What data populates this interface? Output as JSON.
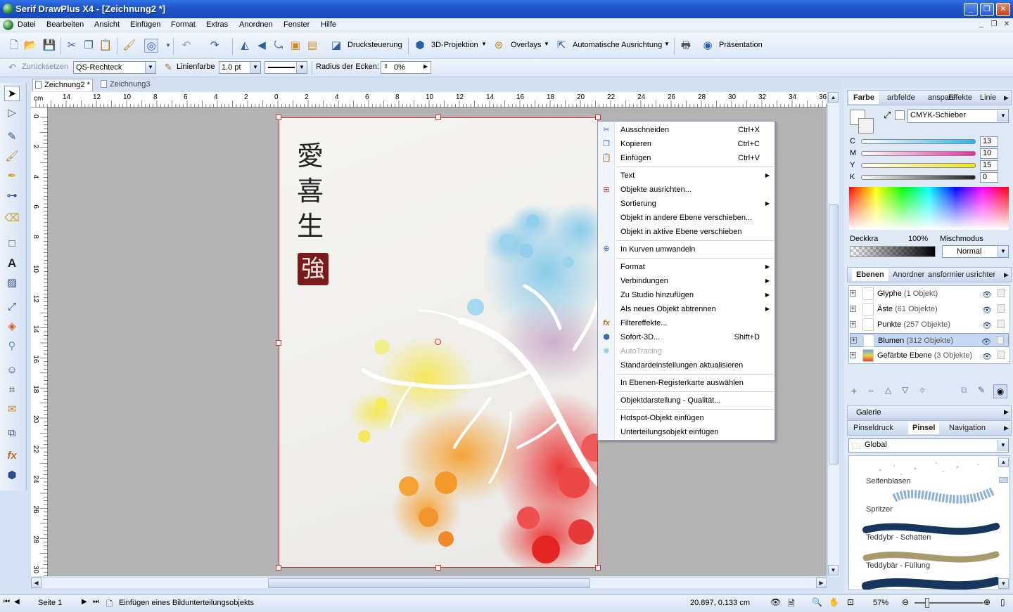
{
  "window": {
    "title": "Serif DrawPlus X4 - [Zeichnung2 *]",
    "min": "_",
    "max": "❐",
    "close": "✕"
  },
  "menu": [
    "Datei",
    "Bearbeiten",
    "Ansicht",
    "Einfügen",
    "Format",
    "Extras",
    "Anordnen",
    "Fenster",
    "Hilfe"
  ],
  "toolbar1": {
    "druck": "Drucksteuerung",
    "projektion": "3D-Projektion",
    "overlays": "Overlays",
    "ausrichtung": "Automatische Ausrichtung",
    "praesentation": "Präsentation"
  },
  "toolbar2": {
    "reset": "Zurücksetzen",
    "shape": "QS-Rechteck",
    "linecolor": "Linienfarbe",
    "linewidth": "1.0 pt",
    "corner_label": "Radius der Ecken:",
    "corner_value": "0%"
  },
  "doctabs": [
    "Zeichnung2 *",
    "Zeichnung3"
  ],
  "ruler": {
    "unit": "cm",
    "h": [
      "14",
      "12",
      "10",
      "8",
      "6",
      "4",
      "2",
      "0",
      "2",
      "4",
      "6",
      "8",
      "10",
      "12",
      "14",
      "16",
      "18",
      "20",
      "22",
      "24",
      "26",
      "28",
      "30",
      "32",
      "34",
      "36"
    ],
    "v": [
      "0",
      "2",
      "4",
      "6",
      "8",
      "10",
      "12",
      "14",
      "16",
      "18",
      "20",
      "22",
      "24",
      "26",
      "28",
      "30"
    ]
  },
  "artwork": {
    "glyphs": [
      "愛",
      "喜",
      "生"
    ],
    "seal": "強"
  },
  "context_menu": [
    {
      "label": "Ausschneiden",
      "shortcut": "Ctrl+X",
      "icon": "cut-icon"
    },
    {
      "label": "Kopieren",
      "shortcut": "Ctrl+C",
      "icon": "copy-icon"
    },
    {
      "label": "Einfügen",
      "shortcut": "Ctrl+V",
      "icon": "paste-icon"
    },
    {
      "label": "Text",
      "submenu": true
    },
    {
      "label": "Objekte ausrichten...",
      "icon": "align-icon"
    },
    {
      "label": "Sortierung",
      "submenu": true
    },
    {
      "label": "Objekt in andere Ebene verschieben..."
    },
    {
      "label": "Objekt in aktive Ebene verschieben"
    },
    {
      "label": "In Kurven umwandeln",
      "icon": "curves-icon"
    },
    {
      "label": "Format",
      "submenu": true
    },
    {
      "label": "Verbindungen",
      "submenu": true
    },
    {
      "label": "Zu Studio hinzufügen",
      "submenu": true
    },
    {
      "label": "Als neues Objekt abtrennen",
      "submenu": true
    },
    {
      "label": "Filtereffekte...",
      "icon": "fx-icon"
    },
    {
      "label": "Sofort-3D...",
      "shortcut": "Shift+D",
      "icon": "3d-icon"
    },
    {
      "label": "AutoTracing",
      "disabled": true,
      "icon": "autotrace-icon"
    },
    {
      "label": "Standardeinstellungen aktualisieren"
    },
    {
      "label": "In Ebenen-Registerkarte auswählen"
    },
    {
      "label": "Objektdarstellung - Qualität..."
    },
    {
      "label": "Hotspot-Objekt einfügen"
    },
    {
      "label": "Unterteilungsobjekt einfügen"
    }
  ],
  "colorpanel": {
    "tabs": [
      "Farbe",
      "arbfelde",
      "anspare",
      "Effekte",
      "Linie"
    ],
    "mode": "CMYK-Schieber",
    "c": "13",
    "m": "10",
    "y": "15",
    "k": "0",
    "c_label": "C",
    "m_label": "M",
    "y_label": "Y",
    "k_label": "K",
    "opacity_label": "Deckkra",
    "opacity": "100%",
    "blend_label": "Mischmodus",
    "blend": "Normal"
  },
  "layers": {
    "tabs": [
      "Ebenen",
      "Anordner",
      "ansformier",
      "usrichter"
    ],
    "items": [
      {
        "name": "Glyphe",
        "count": "(1 Objekt)"
      },
      {
        "name": "Äste",
        "count": "(61 Objekte)"
      },
      {
        "name": "Punkte",
        "count": "(257 Objekte)"
      },
      {
        "name": "Blumen",
        "count": "(312 Objekte)"
      },
      {
        "name": "Gefärbte Ebene",
        "count": "(3 Objekte)"
      }
    ]
  },
  "gallery": {
    "title": "Galerie"
  },
  "brushes": {
    "tabs": [
      "Pinseldruck",
      "Pinsel",
      "Navigation"
    ],
    "category": "Global",
    "items": [
      "Seifenblasen",
      "Spritzer",
      "Teddybr - Schatten",
      "Teddybär - Füllung"
    ]
  },
  "status": {
    "page": "Seite 1",
    "message": "Einfügen eines Bildunterteilungsobjekts",
    "coords": "20.897, 0.133 cm",
    "zoom": "57%"
  }
}
